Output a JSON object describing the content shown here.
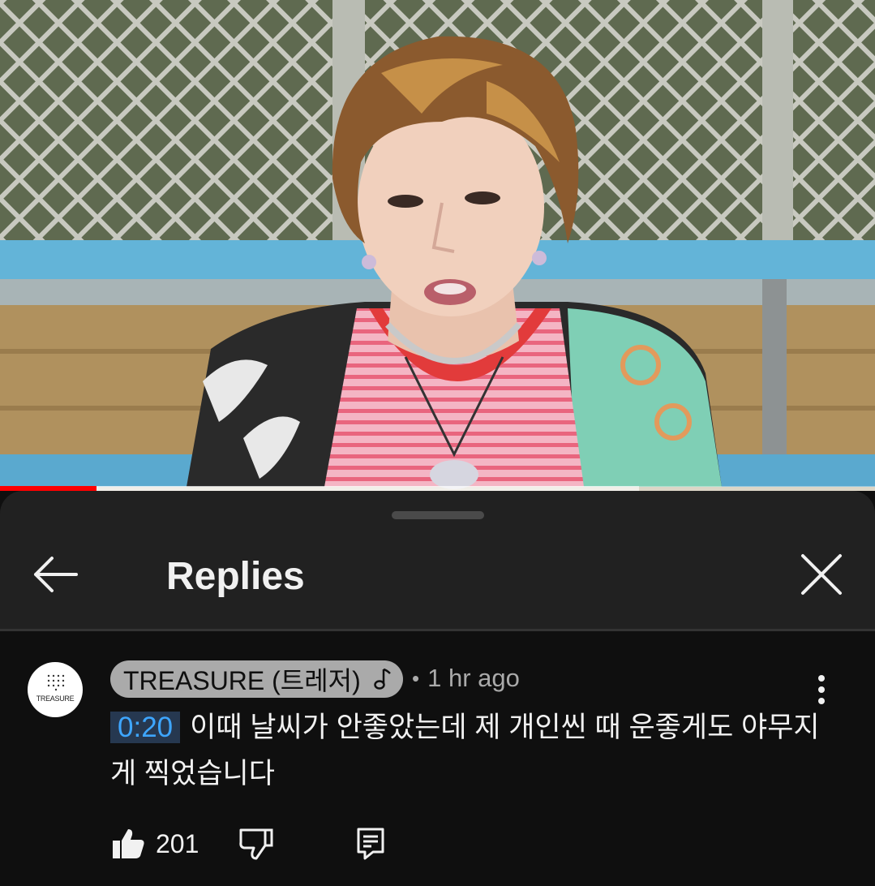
{
  "video": {
    "progress_fraction": 0.11,
    "buffered_fraction": 0.73,
    "colors": {
      "progress": "#ff0000",
      "buffer": "#ffffff"
    }
  },
  "sheet": {
    "title": "Replies",
    "back_icon": "arrow-left-icon",
    "close_icon": "close-icon"
  },
  "comment": {
    "avatar_text": "TREASURE",
    "author": "TREASURE (트레저)",
    "author_badge_icon": "music-note-icon",
    "meta_dot": "•",
    "time_ago": "1 hr ago",
    "timestamp": "0:20",
    "text": "이때 날씨가 안좋았는데 제 개인씬 때 운좋게도 야무지게 찍었습니다",
    "likes": "201",
    "colors": {
      "timestamp_text": "#3ea6ff",
      "timestamp_bg": "#263850",
      "author_chip": "#aaaaaa"
    }
  }
}
